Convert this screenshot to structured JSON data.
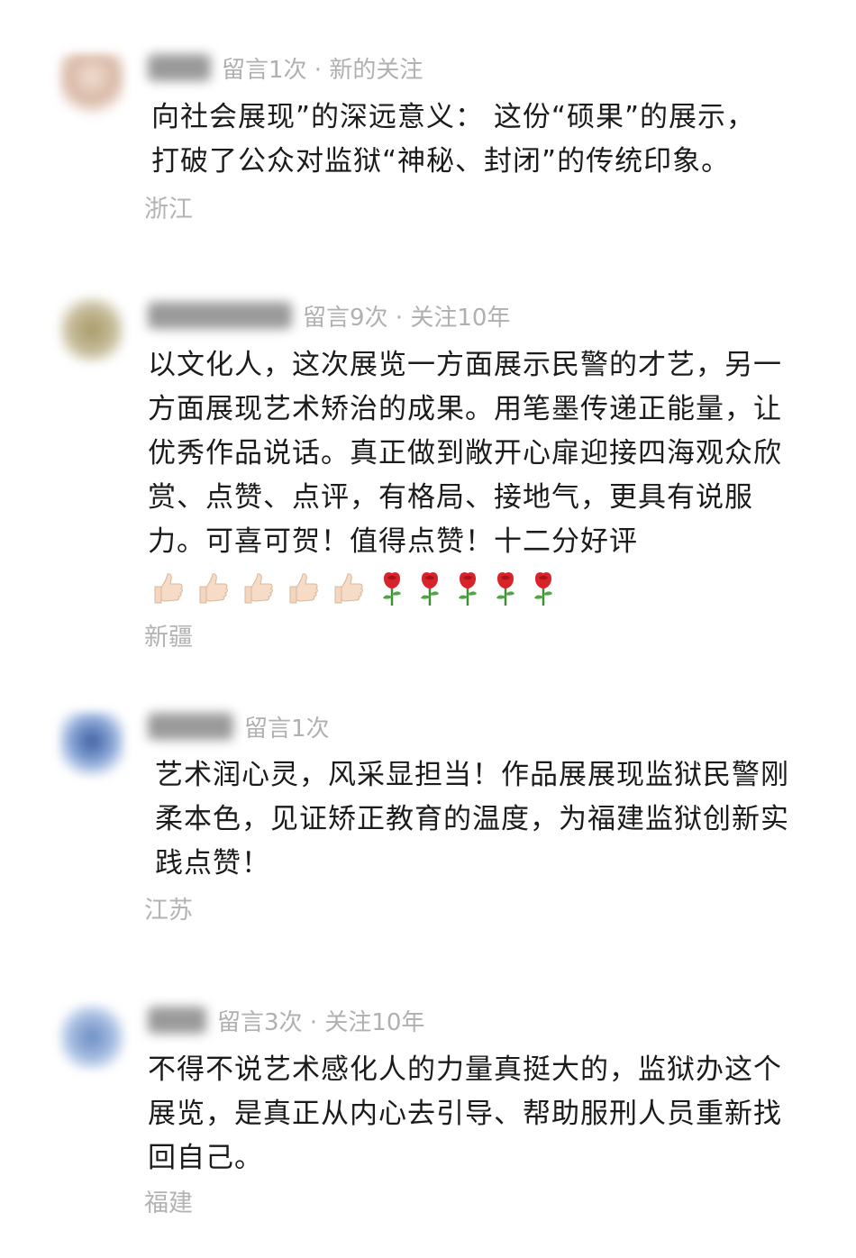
{
  "comments": [
    {
      "avatar_color": "#e8d2c6",
      "meta": "留言1次 · 新的关注",
      "text": "向社会展现”的深远意义： 这份“硕果”的展示，\n打破了公众对监狱“神秘、封闭”的传统印象。",
      "location": "浙江"
    },
    {
      "avatar_color": "#b8ad8a",
      "meta": "留言9次 · 关注10年",
      "text": "以文化人，这次展览一方面展示民警的才艺，另一方面展现艺术矫治的成果。用笔墨传递正能量，让优秀作品说话。真正做到敞开心扉迎接四海观众欣赏、点赞、点评，有格局、接地气，更具有说服力。可喜可贺！值得点赞！十二分好评",
      "emojis": [
        "thumbs-up",
        "thumbs-up",
        "thumbs-up",
        "thumbs-up",
        "thumbs-up",
        "rose",
        "rose",
        "rose",
        "rose",
        "rose"
      ],
      "location": "新疆"
    },
    {
      "avatar_color": "#7f95c4",
      "meta": "留言1次",
      "text": "艺术润心灵，风采显担当！作品展展现监狱民警刚柔本色，见证矫正教育的温度，为福建监狱创新实践点赞！",
      "location": "江苏"
    },
    {
      "avatar_color": "#8fa6cf",
      "meta": "留言3次 · 关注10年",
      "text": "不得不说艺术感化人的力量真挺大的，监狱办这个展览，是真正从内心去引导、帮助服刑人员重新找回自己。",
      "location": "福建"
    }
  ]
}
